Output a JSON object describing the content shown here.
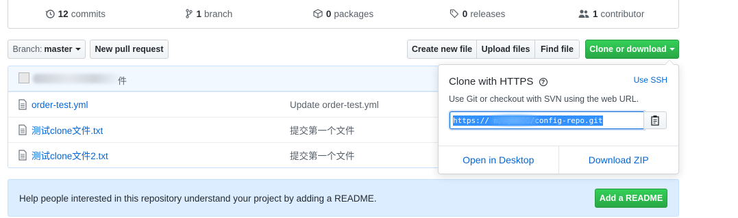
{
  "stats": {
    "commits": {
      "count": "12",
      "label": "commits",
      "icon": "history-icon"
    },
    "branches": {
      "count": "1",
      "label": "branch",
      "icon": "git-branch-icon"
    },
    "packages": {
      "count": "0",
      "label": "packages",
      "icon": "package-icon"
    },
    "releases": {
      "count": "0",
      "label": "releases",
      "icon": "tag-icon"
    },
    "contributors": {
      "count": "1",
      "label": "contributor",
      "icon": "people-icon"
    }
  },
  "toolbar": {
    "branch_label": "Branch:",
    "branch_value": "master",
    "new_pr": "New pull request",
    "create_file": "Create new file",
    "upload_files": "Upload files",
    "find_file": "Find file",
    "clone_download": "Clone or download"
  },
  "commit_bar": {
    "message_tail": "件"
  },
  "files": [
    {
      "name": "order-test.yml",
      "message": "Update order-test.yml",
      "icon": "file-icon"
    },
    {
      "name": "测试clone文件.txt",
      "message": "提交第一个文件",
      "icon": "file-icon"
    },
    {
      "name": "测试clone文件2.txt",
      "message": "提交第一个文件",
      "icon": "file-icon"
    }
  ],
  "readme": {
    "text": "Help people interested in this repository understand your project by adding a README.",
    "button": "Add a README"
  },
  "clone_panel": {
    "title": "Clone with HTTPS",
    "use_ssh": "Use SSH",
    "description": "Use Git or checkout with SVN using the web URL.",
    "url": "https://           m/xyh668/config-repo.git",
    "open_desktop": "Open in Desktop",
    "download_zip": "Download ZIP"
  },
  "colors": {
    "link": "#0366d6",
    "green": "#28a745",
    "banner_bg": "#dbedff"
  }
}
